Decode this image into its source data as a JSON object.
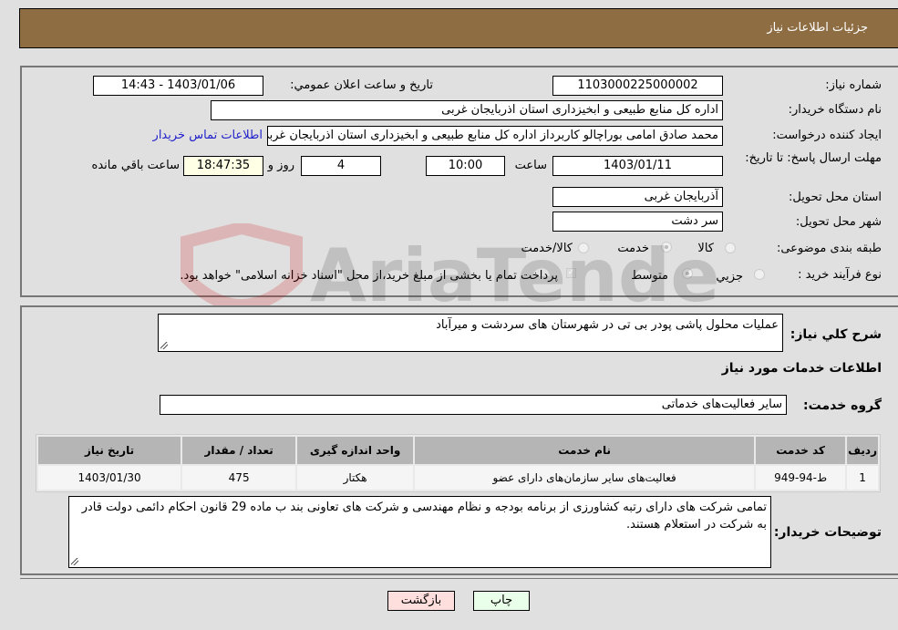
{
  "header": {
    "title": "جزئیات اطلاعات نیاز"
  },
  "fields": {
    "need_number_label": "شماره نیاز:",
    "need_number": "1103000225000002",
    "announce_label": "تاریخ و ساعت اعلان عمومي:",
    "announce_value": "1403/01/06 - 14:43",
    "buyer_org_label": "نام دستگاه خريدار:",
    "buyer_org": "اداره کل منابع طبیعی و ابخیزداری استان اذربایجان غربی",
    "creator_label": "ایجاد کننده درخواست:",
    "creator": "محمد صادق امامی بوراچالو کاربرداز اداره کل منابع طبیعی و ابخیزداری استان اذربایجان غربی",
    "contact_link": "اطلاعات تماس خریدار",
    "deadline_label": "مهلت ارسال پاسخ: تا تاریخ:",
    "deadline_date": "1403/01/11",
    "time_label": "ساعت",
    "deadline_time": "10:00",
    "days_value": "4",
    "days_label": "روز و",
    "remaining_time": "18:47:35",
    "remaining_label": "ساعت باقي مانده",
    "province_label": "استان محل تحویل:",
    "province": "آذربایجان غربی",
    "city_label": "شهر محل تحویل:",
    "city": "سر دشت",
    "category_label": "طبقه بندی موضوعی:",
    "category_options": [
      "کالا",
      "خدمت",
      "کالا/خدمت"
    ],
    "category_selected": "خدمت",
    "process_label": "نوع فرآیند خرید :",
    "process_options": [
      "جزيي",
      "متوسط"
    ],
    "process_selected": "متوسط",
    "treasury_note": "پرداخت تمام یا بخشی از مبلغ خرید،از محل \"اسناد خزانه اسلامی\" خواهد بود."
  },
  "details": {
    "summary_label": "شرح کلي نياز:",
    "summary": "عملیات محلول پاشی پودر بی تی در شهرستان های سردشت و میرآباد",
    "services_heading": "اطلاعات خدمات مورد نياز",
    "service_group_label": "گروه خدمت:",
    "service_group": "سایر فعالیت‌های خدماتی",
    "table": {
      "headers": [
        "رديف",
        "کد خدمت",
        "نام خدمت",
        "واحد اندازه گیری",
        "تعداد / مقدار",
        "تاریخ نیاز"
      ],
      "rows": [
        [
          "1",
          "ط-94-949",
          "فعالیت‌های سایر سازمان‌های دارای عضو",
          "هکتار",
          "475",
          "1403/01/30"
        ]
      ]
    },
    "buyer_notes_label": "توضیحات خریدار:",
    "buyer_notes": "تمامی شرکت های دارای رتبه کشاورزی از برنامه بودجه و نظام مهندسی و شرکت های تعاونی بند ب ماده 29 قانون احکام دائمی دولت قادر به شرکت در استعلام هستند."
  },
  "buttons": {
    "print": "چاپ",
    "back": "بازگشت"
  },
  "watermark": {
    "text": "AriaTender.neT"
  }
}
